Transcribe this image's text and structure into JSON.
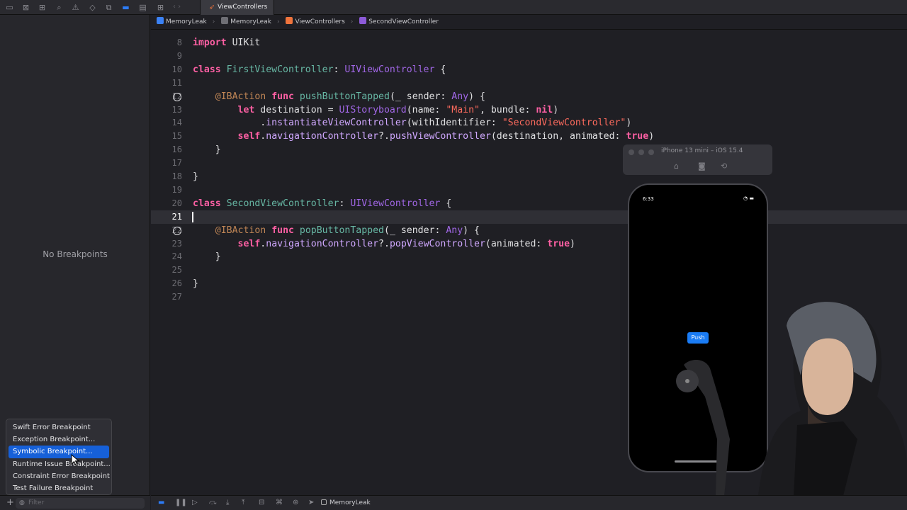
{
  "tab": {
    "title": "ViewControllers"
  },
  "breadcrumb": [
    "MemoryLeak",
    "MemoryLeak",
    "ViewControllers",
    "SecondViewController"
  ],
  "navigator": {
    "empty_message": "No Breakpoints"
  },
  "breakpoint_menu": {
    "items": [
      "Swift Error Breakpoint",
      "Exception Breakpoint...",
      "Symbolic Breakpoint...",
      "Runtime Issue Breakpoint...",
      "Constraint Error Breakpoint",
      "Test Failure Breakpoint"
    ],
    "selected_index": 2
  },
  "filter": {
    "placeholder": "Filter"
  },
  "editor": {
    "current_line": 21,
    "lines": [
      {
        "n": "8",
        "text": "import UIKit"
      },
      {
        "n": "9",
        "text": ""
      },
      {
        "n": "10",
        "text": "class FirstViewController: UIViewController {"
      },
      {
        "n": "11",
        "text": ""
      },
      {
        "n": "12",
        "text": "    @IBAction func pushButtonTapped(_ sender: Any) {",
        "breakpoint": true
      },
      {
        "n": "13",
        "text": "        let destination = UIStoryboard(name: \"Main\", bundle: nil)"
      },
      {
        "n": "14",
        "text": "            .instantiateViewController(withIdentifier: \"SecondViewController\")"
      },
      {
        "n": "15",
        "text": "        self.navigationController?.pushViewController(destination, animated: true)"
      },
      {
        "n": "16",
        "text": "    }"
      },
      {
        "n": "17",
        "text": ""
      },
      {
        "n": "18",
        "text": "}"
      },
      {
        "n": "19",
        "text": ""
      },
      {
        "n": "20",
        "text": "class SecondViewController: UIViewController {"
      },
      {
        "n": "21",
        "text": ""
      },
      {
        "n": "22",
        "text": "    @IBAction func popButtonTapped(_ sender: Any) {",
        "breakpoint": true
      },
      {
        "n": "23",
        "text": "        self.navigationController?.popViewController(animated: true)"
      },
      {
        "n": "24",
        "text": "    }"
      },
      {
        "n": "25",
        "text": ""
      },
      {
        "n": "26",
        "text": "}"
      },
      {
        "n": "27",
        "text": ""
      }
    ]
  },
  "simulator": {
    "title": "iPhone 13 mini – iOS 15.4",
    "time": "6:33",
    "push_label": "Push"
  },
  "debug": {
    "target": "MemoryLeak"
  }
}
